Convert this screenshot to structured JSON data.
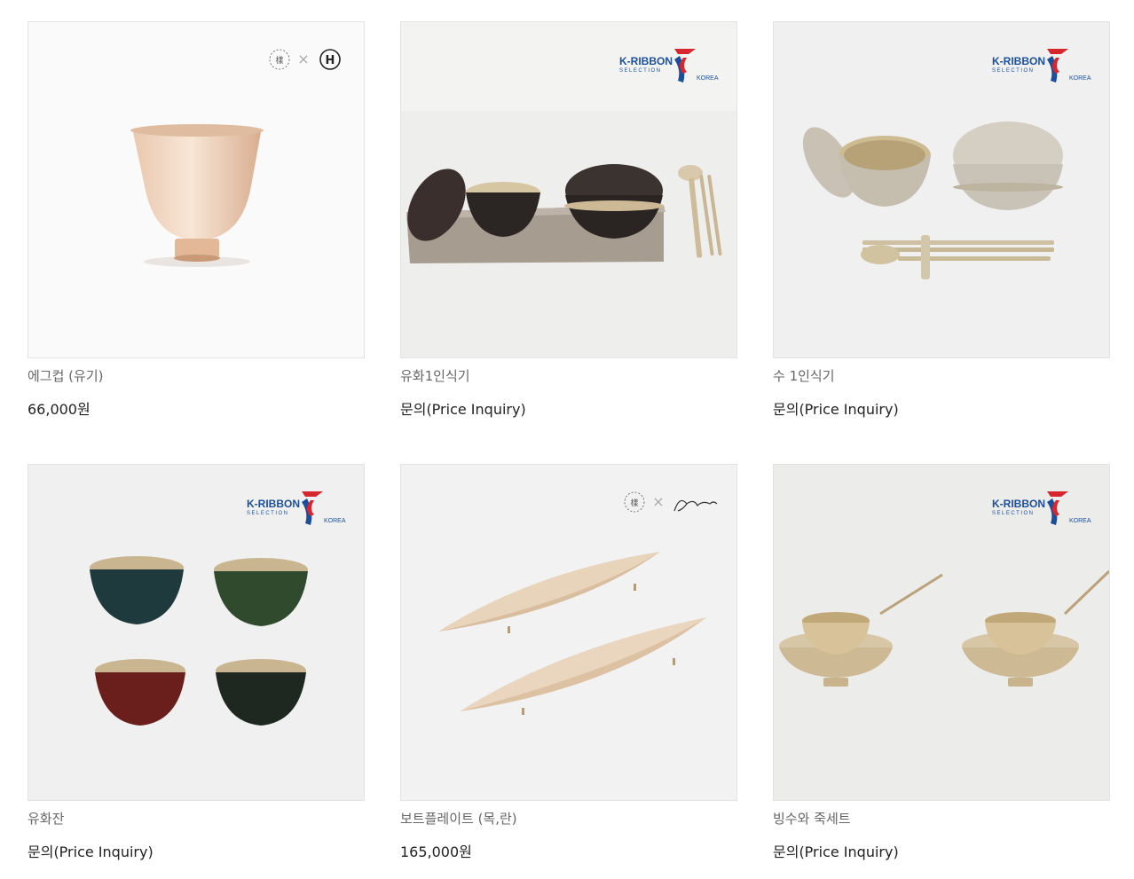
{
  "products": [
    {
      "name": "에그컵 (유기)",
      "price": "66,000원",
      "logo": "changsuljo-x-h-logo"
    },
    {
      "name": "유화1인식기",
      "price": "문의(Price Inquiry)",
      "logo": "k-ribbon-logo"
    },
    {
      "name": "수 1인식기",
      "price": "문의(Price Inquiry)",
      "logo": "k-ribbon-logo"
    },
    {
      "name": "유화잔",
      "price": "문의(Price Inquiry)",
      "logo": "k-ribbon-logo"
    },
    {
      "name": "보트플레이트 (목,란)",
      "price": "165,000원",
      "logo": "changsuljo-x-studio-logo"
    },
    {
      "name": "빙수와 죽세트",
      "price": "문의(Price Inquiry)",
      "logo": "k-ribbon-logo"
    }
  ],
  "logos": {
    "k_ribbon_title": "K-RIBBON",
    "k_ribbon_sub": "SELECTION",
    "k_ribbon_korea": "KOREA"
  },
  "colors": {
    "ribbon_blue": "#1b4f9c",
    "ribbon_red": "#d8262f",
    "brass": "#c9b48e"
  }
}
